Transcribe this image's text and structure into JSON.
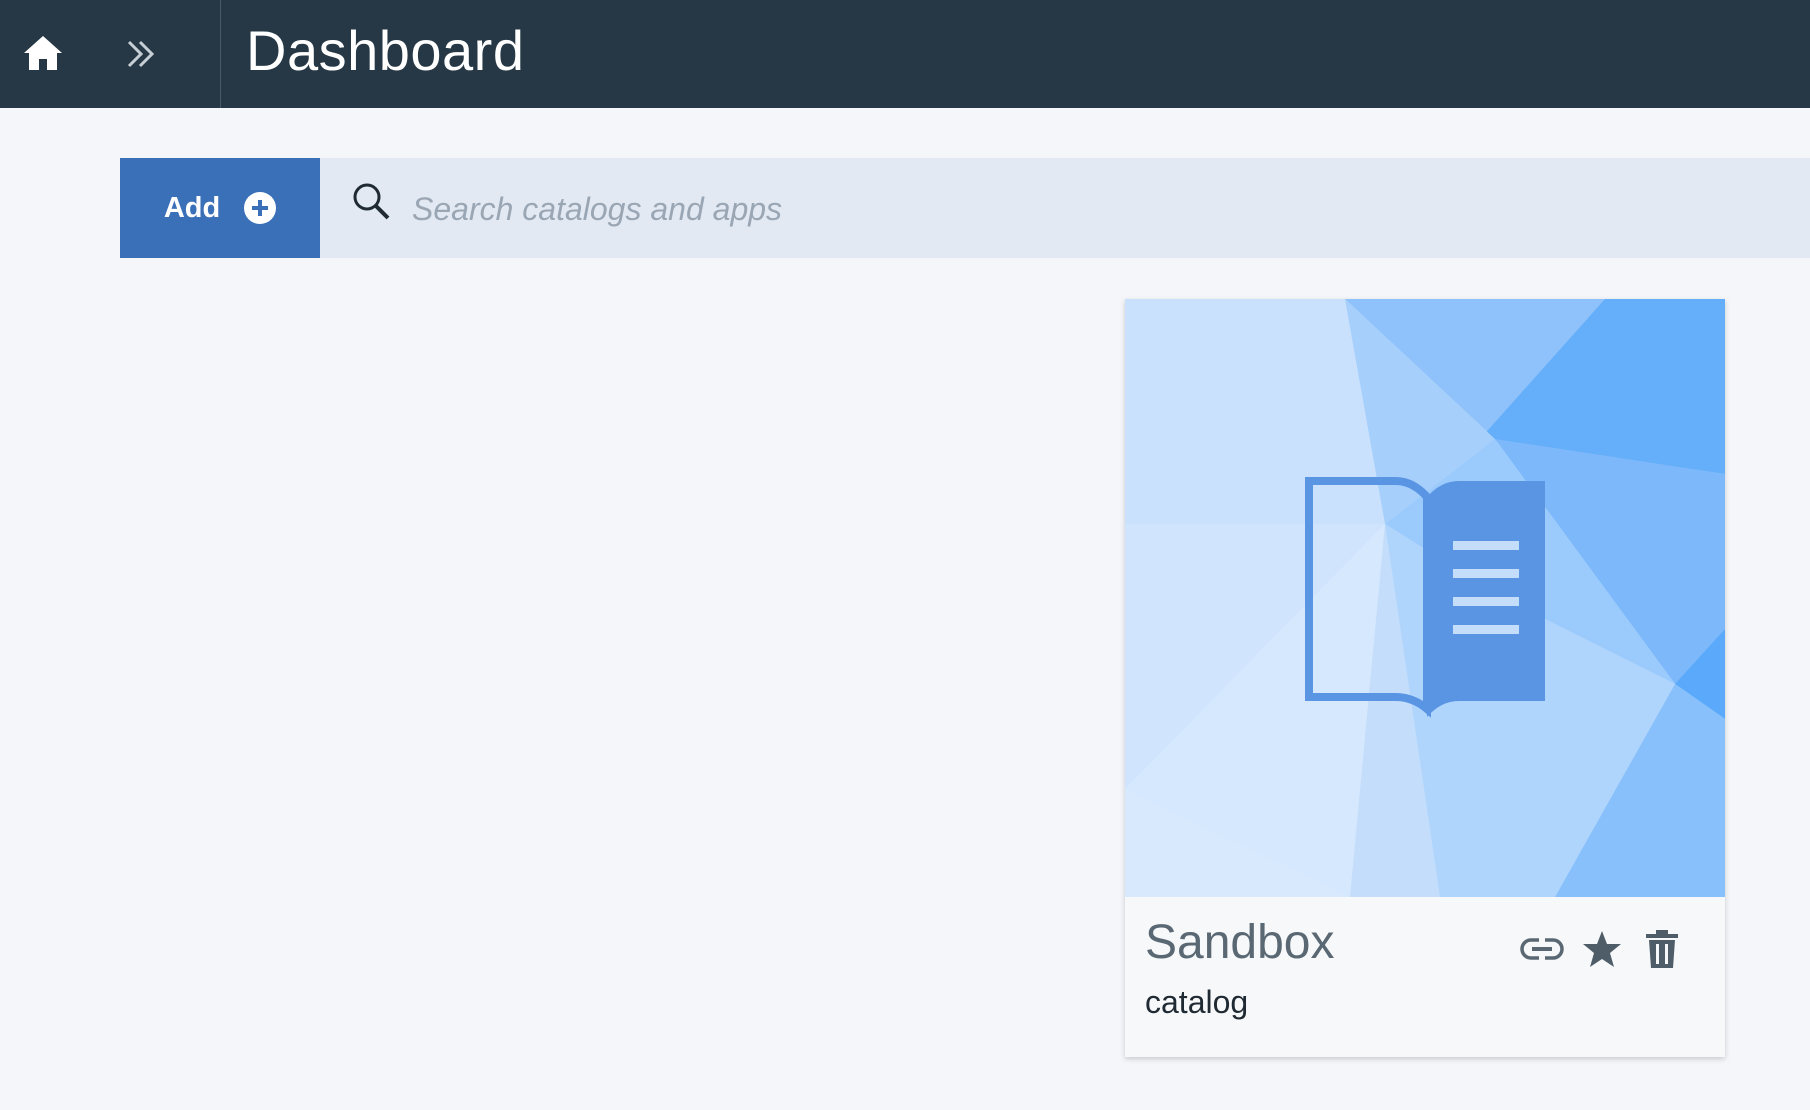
{
  "header": {
    "title": "Dashboard",
    "home_icon": "home-icon",
    "expand_icon": "double-chevron-right-icon",
    "background_color": "#263845"
  },
  "toolbar": {
    "add_label": "Add",
    "add_icon": "plus-circle-icon",
    "add_color": "#3a70b8",
    "search_placeholder": "Search catalogs and apps",
    "search_value": "",
    "search_icon": "search-icon"
  },
  "cards": [
    {
      "title": "Sandbox",
      "type": "catalog",
      "icon": "catalog-book-icon",
      "actions": [
        "link-icon",
        "star-icon",
        "trash-icon"
      ]
    }
  ]
}
